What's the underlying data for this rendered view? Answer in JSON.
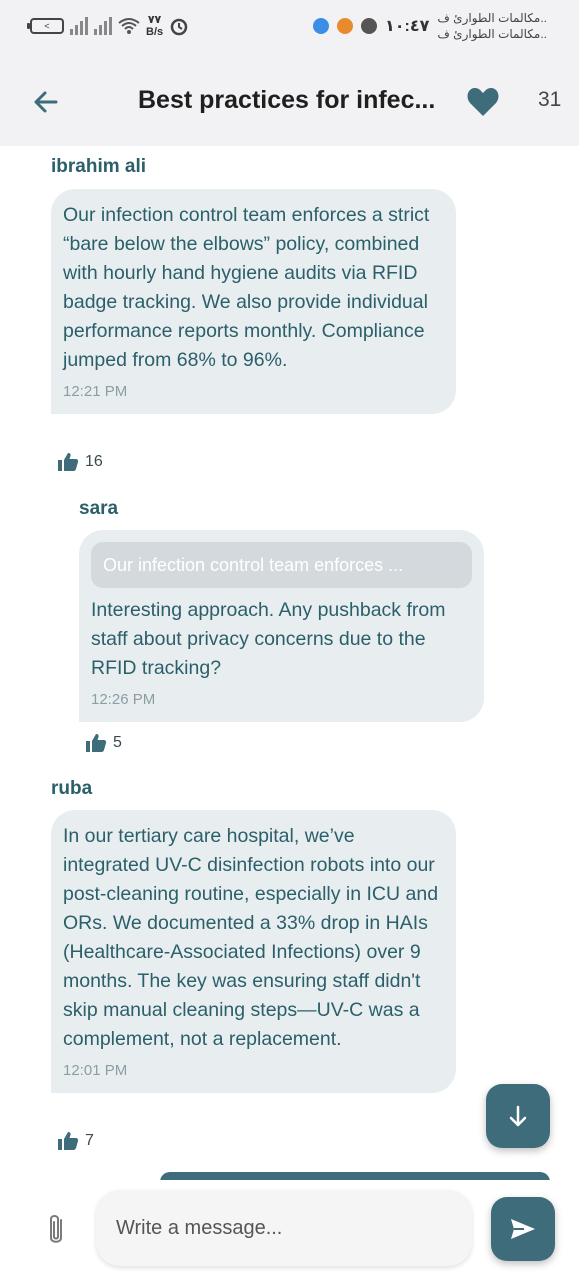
{
  "status_bar": {
    "battery_label": "<",
    "speed_value": "٧٧",
    "speed_unit": "B/s",
    "time": "١٠:٤٧",
    "notification_lines": [
      "مكالمات الطوارئ ف..",
      "مكالمات الطوارئ ف.."
    ]
  },
  "header": {
    "title": "Best practices for infec...",
    "like_count": "31",
    "icons": {
      "back": "arrow-left-icon",
      "like": "heart-icon"
    }
  },
  "messages": [
    {
      "author": "ibrahim ali",
      "text": "Our infection control team enforces a strict “bare below the elbows” policy, combined with hourly hand hygiene audits via RFID badge tracking. We also provide individual performance reports monthly. Compliance jumped from 68% to 96%.",
      "time": "12:21 PM",
      "likes": "16"
    },
    {
      "author": "sara",
      "quote": "Our infection control team enforces ...",
      "text": "Interesting approach. Any pushback from staff about privacy concerns due to the RFID tracking?",
      "time": "12:26 PM",
      "likes": "5"
    },
    {
      "author": "ruba",
      "text": "In our tertiary care hospital, we’ve integrated UV-C disinfection robots into our post-cleaning routine, especially in ICU and ORs. We documented a 33% drop in HAIs (Healthcare-Associated Infections) over 9 months.  The key was ensuring staff didn't skip manual cleaning steps—UV-C was a complement, not a replacement.",
      "time": "12:01 PM",
      "likes": "7"
    }
  ],
  "composer": {
    "placeholder": "Write a message...",
    "icons": {
      "attach": "paperclip-icon",
      "send": "send-icon",
      "scroll": "arrow-down-icon"
    }
  },
  "colors": {
    "accent": "#3e6c7a",
    "bubble": "#e8eef0",
    "header_bg": "#f2f2f4",
    "text": "#2b5f6a"
  }
}
